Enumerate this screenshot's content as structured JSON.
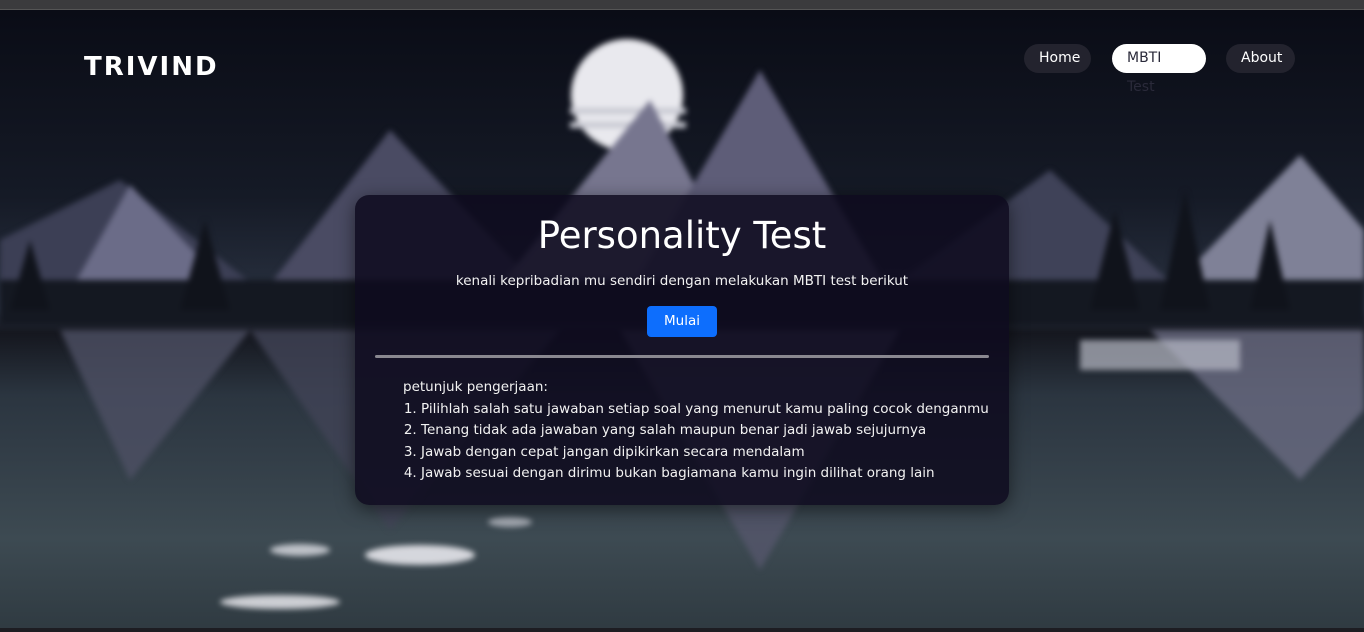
{
  "brand": "TRIVIND",
  "nav": [
    {
      "label": "Home",
      "active": false
    },
    {
      "label": "MBTI Test",
      "active": true
    },
    {
      "label": "About",
      "active": false
    }
  ],
  "card": {
    "title": "Personality Test",
    "subtitle": "kenali kepribadian mu sendiri dengan melakukan MBTI test berikut",
    "button_label": "Mulai",
    "instructions_heading": "petunjuk pengerjaan:",
    "instructions": [
      "Pilihlah salah satu jawaban setiap soal yang menurut kamu paling cocok denganmu",
      "Tenang tidak ada jawaban yang salah maupun benar jadi jawab sejujurnya",
      "Jawab dengan cepat jangan dipikirkan secara mendalam",
      "Jawab sesuai dengan dirimu bukan bagiamana kamu ingin dilihat orang lain"
    ]
  },
  "colors": {
    "accent_button": "#0d6efd",
    "card_bg": "#0e0a1e",
    "nav_active_bg": "#ffffff",
    "nav_bg": "#23232e"
  },
  "background_image": "night-mountain-lake-landscape"
}
